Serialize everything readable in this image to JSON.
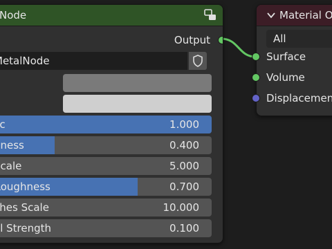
{
  "left_node": {
    "title": "Node",
    "output_label": "Output",
    "name_field": "MetalNode",
    "fields": [
      {
        "label": "lic",
        "value": "1.000",
        "fill": 1.0
      },
      {
        "label": "hness",
        "value": "0.400",
        "fill": 0.28
      },
      {
        "label": "Scale",
        "value": "5.000",
        "fill": 0
      },
      {
        "label": "Roughness",
        "value": "0.700",
        "fill": 0.66
      },
      {
        "label": "ches Scale",
        "value": "10.000",
        "fill": 0
      },
      {
        "label": "al Strength",
        "value": "0.100",
        "fill": 0
      }
    ],
    "swatch_colors": [
      "#7a7a7a",
      "#cfcfcf"
    ]
  },
  "right_node": {
    "title": "Material Ou",
    "target_select": "All",
    "inputs": [
      "Surface",
      "Volume",
      "Displacement"
    ]
  },
  "colors": {
    "socket_shader": "#63c763",
    "socket_vector": "#6363c7",
    "link": "#63c763",
    "slider_fill": "#4772b3"
  }
}
